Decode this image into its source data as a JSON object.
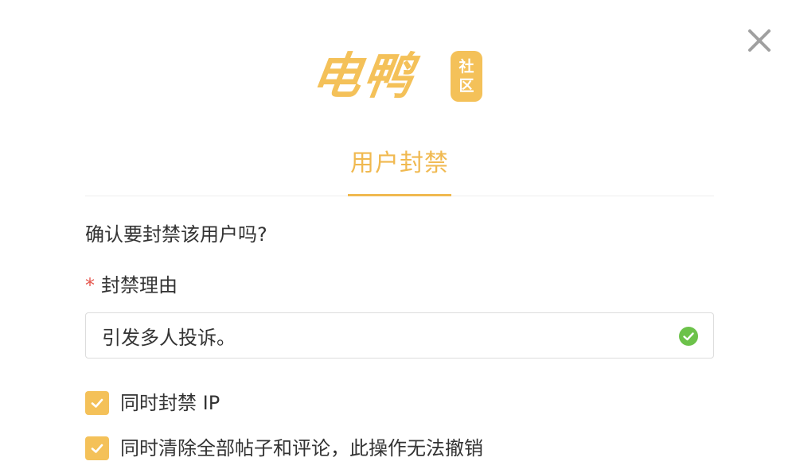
{
  "logo": {
    "main_text": "电鸭",
    "badge_line1": "社",
    "badge_line2": "区"
  },
  "tabs": [
    {
      "label": "用户封禁",
      "active": true
    }
  ],
  "dialog": {
    "confirm_text": "确认要封禁该用户吗?",
    "reason_field": {
      "required_mark": "*",
      "label": "封禁理由",
      "value": "引发多人投诉。",
      "valid": true
    },
    "options": [
      {
        "label": "同时封禁 IP",
        "checked": true
      },
      {
        "label": "同时清除全部帖子和评论，此操作无法撤销",
        "checked": true
      }
    ]
  },
  "icons": {
    "close": "close-icon",
    "valid": "check-circle-icon",
    "checkbox": "check-icon"
  },
  "colors": {
    "accent": "#f0b950",
    "logo": "#f4c159",
    "required": "#e5574e",
    "valid": "#6cc24a",
    "close": "#a0a0a0"
  }
}
